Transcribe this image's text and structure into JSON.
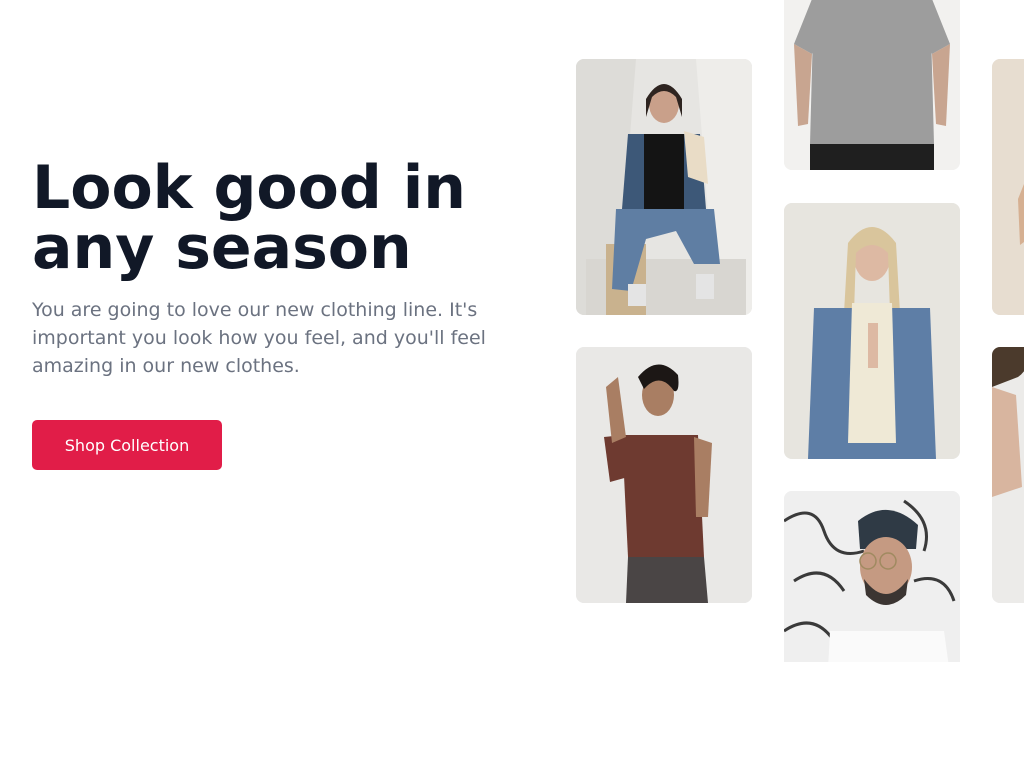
{
  "hero": {
    "headline_line1": "Look good in",
    "headline_line2": "any season",
    "description": "You are going to love our new clothing line. It's important you look how you feel, and you'll feel amazing in our new clothes.",
    "cta_label": "Shop Collection"
  },
  "colors": {
    "accent": "#e11d48",
    "headline": "#111827",
    "body_text": "#6b7280"
  }
}
